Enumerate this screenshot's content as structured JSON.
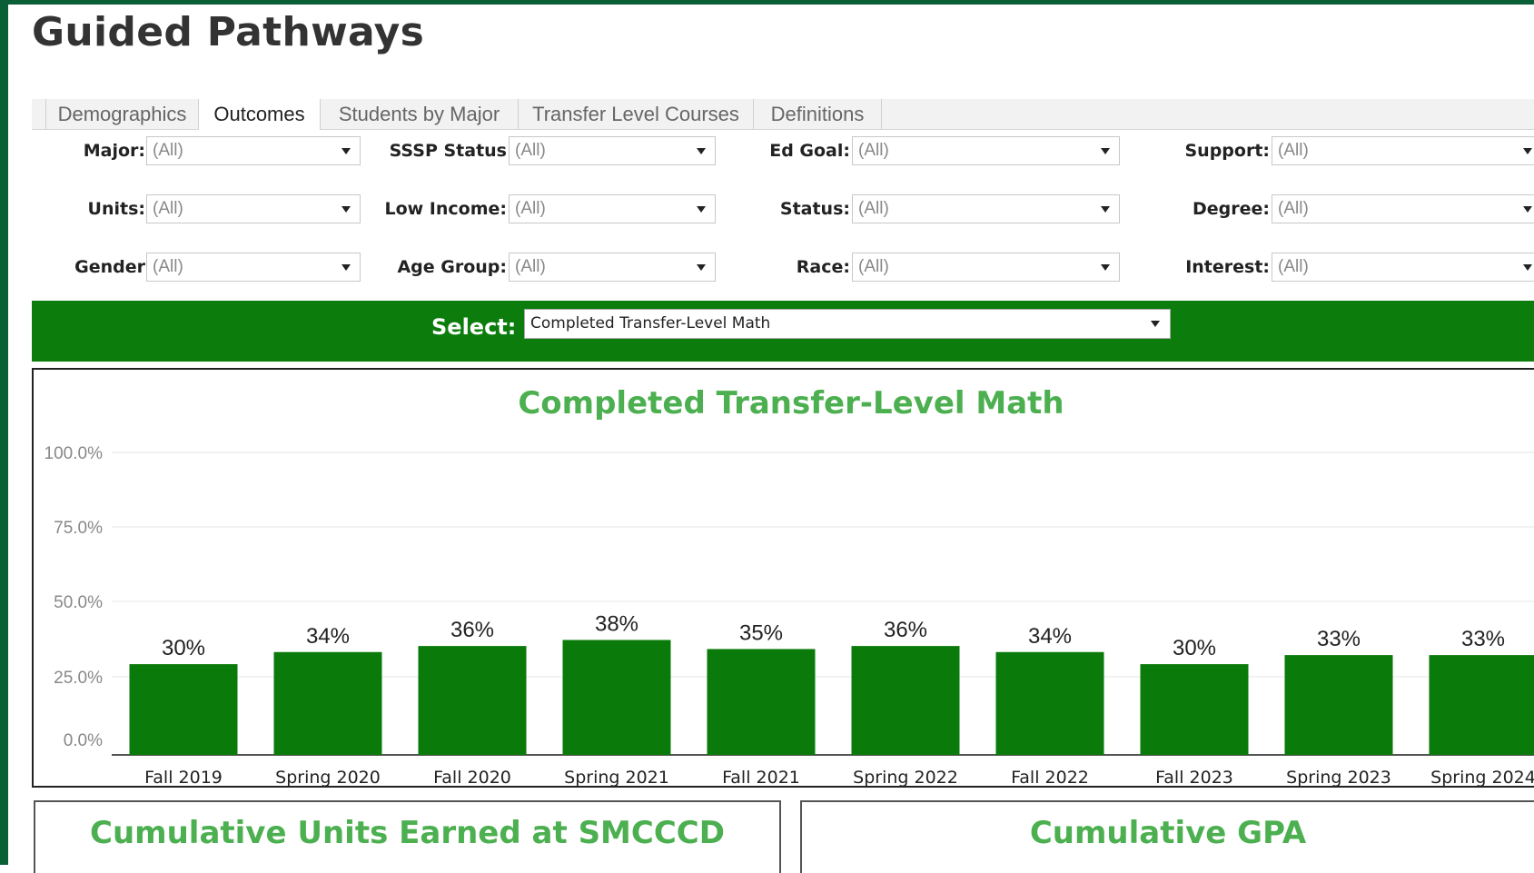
{
  "page": {
    "title": "Guided Pathways"
  },
  "tabs": [
    {
      "label": "Demographics"
    },
    {
      "label": "Outcomes"
    },
    {
      "label": "Students by Major"
    },
    {
      "label": "Transfer Level Courses"
    },
    {
      "label": "Definitions"
    }
  ],
  "active_tab": "Outcomes",
  "filters": [
    {
      "label": "Major:",
      "value": "(All)"
    },
    {
      "label": "SSSP Status",
      "value": "(All)"
    },
    {
      "label": "Ed Goal:",
      "value": "(All)"
    },
    {
      "label": "Support:",
      "value": "(All)"
    },
    {
      "label": "Units:",
      "value": "(All)"
    },
    {
      "label": "Low Income:",
      "value": "(All)"
    },
    {
      "label": "Status:",
      "value": "(All)"
    },
    {
      "label": "Degree:",
      "value": "(All)"
    },
    {
      "label": "Gender",
      "value": "(All)"
    },
    {
      "label": "Age Group:",
      "value": "(All)"
    },
    {
      "label": "Race:",
      "value": "(All)"
    },
    {
      "label": "Interest:",
      "value": "(All)"
    }
  ],
  "selector": {
    "label": "Select:",
    "value": "Completed Transfer-Level Math"
  },
  "colors": {
    "frame": "#0b5f36",
    "bar": "#0a7a0a",
    "title_green": "#4caf50",
    "select_bar": "#0c7d0c"
  },
  "chart_data": {
    "type": "bar",
    "title": "Completed Transfer-Level Math",
    "categories": [
      "Fall 2019",
      "Spring 2020",
      "Fall 2020",
      "Spring 2021",
      "Fall 2021",
      "Spring 2022",
      "Fall 2022",
      "Fall 2023",
      "Spring 2023",
      "Spring 2024"
    ],
    "values": [
      30,
      34,
      36,
      38,
      35,
      36,
      34,
      30,
      33,
      33
    ],
    "data_labels": [
      "30%",
      "34%",
      "36%",
      "38%",
      "35%",
      "36%",
      "34%",
      "30%",
      "33%",
      "33%"
    ],
    "y_ticks": [
      "100.0%",
      "75.0%",
      "50.0%",
      "25.0%",
      "0.0%"
    ],
    "ylim": [
      0,
      100
    ],
    "grid": true,
    "legend": "none"
  },
  "bottom_panels": [
    {
      "title": "Cumulative Units Earned at SMCCCD"
    },
    {
      "title": "Cumulative GPA"
    }
  ]
}
